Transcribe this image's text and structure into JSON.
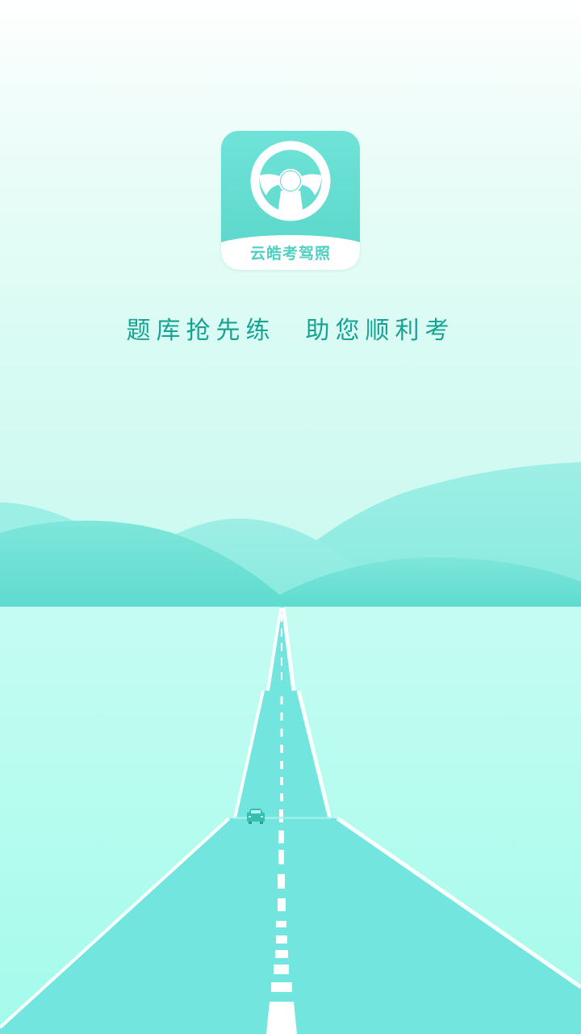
{
  "app": {
    "icon_name": "steering-wheel-icon",
    "icon_label": "云皓考驾照"
  },
  "slogan": "题库抢先练　助您顺利考",
  "illustration": {
    "scene": "road-through-hills",
    "car_icon": "car-icon"
  },
  "colors": {
    "brand": "#5ad6c9",
    "slogan_text": "#17a394",
    "icon_label": "#4fd0c2",
    "hill_light": "#8fece1",
    "hill_dark": "#67ddd2",
    "road": "#72e5de",
    "ground": "#bffdf1"
  }
}
